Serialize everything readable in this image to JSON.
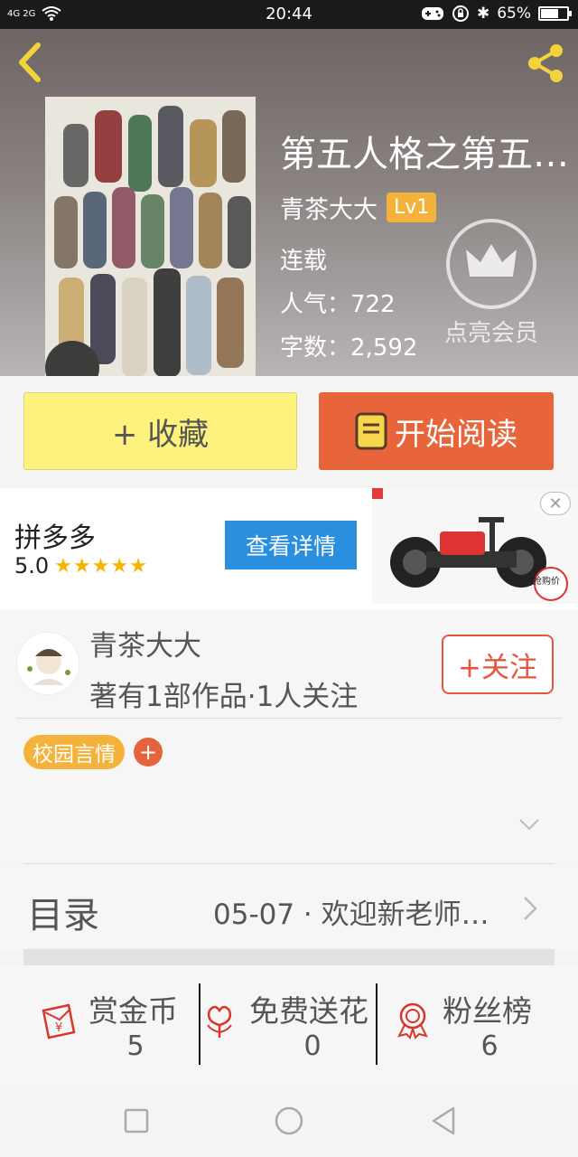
{
  "status_bar": {
    "network": "4G 2G",
    "time": "20:44",
    "battery": "65%",
    "battery_level": 0.65
  },
  "book": {
    "title": "第五人格之第五…",
    "author": "青茶大大",
    "level": "Lv1",
    "status": "连载",
    "popularity_label": "人气：",
    "popularity": "722",
    "words_label": "字数：",
    "words": "2,592",
    "vip_label": "点亮会员"
  },
  "actions": {
    "favorite_label": "+ 收藏",
    "read_label": "开始阅读"
  },
  "ad": {
    "name": "拼多多",
    "rating": "5.0",
    "stars": "★★★★★",
    "button_label": "查看详情",
    "close": "✕",
    "badge": "抢购价"
  },
  "author_card": {
    "name": "青茶大大",
    "info": "著有1部作品·1人关注",
    "follow_label": "+关注",
    "tags": [
      "校园言情"
    ],
    "add_tag": "+"
  },
  "catalog": {
    "label": "目录",
    "latest": "05-07 · 欢迎新老师…"
  },
  "stats": [
    {
      "label": "赏金币",
      "value": "5",
      "icon": "red-envelope-icon"
    },
    {
      "label": "免费送花",
      "value": "0",
      "icon": "flower-icon"
    },
    {
      "label": "粉丝榜",
      "value": "6",
      "icon": "medal-icon"
    }
  ],
  "colors": {
    "accent_orange": "#e8643a",
    "favorite_yellow": "#fcf27d",
    "tag_yellow": "#f3b23a",
    "ad_blue": "#2b8fe0",
    "follow_red": "#e5573c"
  }
}
